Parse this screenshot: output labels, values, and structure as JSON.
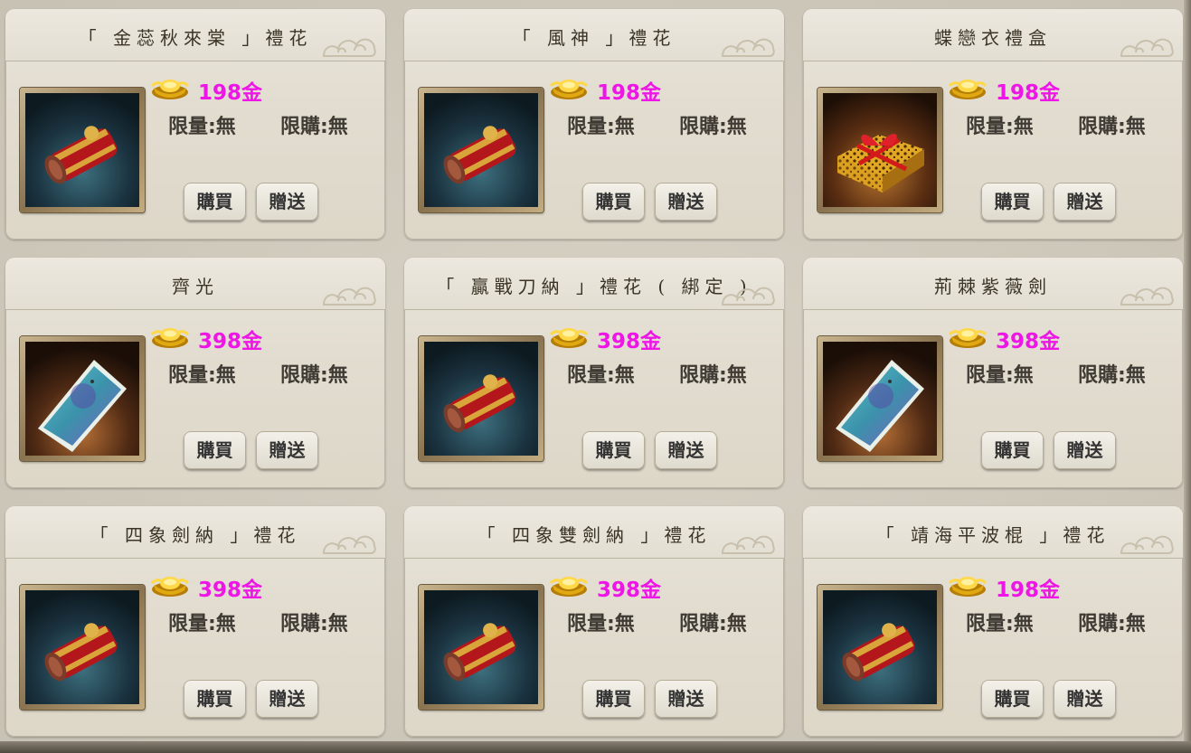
{
  "currency_icon": "gold-ingot-icon",
  "colors": {
    "price": "#ee16e6",
    "card_background": "#e3ded2",
    "text": "#3f3b34"
  },
  "shop": {
    "items": [
      {
        "title": "「 金蕊秋來棠 」禮花",
        "price": "198金",
        "limit_qty": "限量:無",
        "limit_buy": "限購:無",
        "buy_label": "購買",
        "gift_label": "贈送",
        "item_icon": "firework-bundle-icon"
      },
      {
        "title": "「 風神 」禮花",
        "price": "198金",
        "limit_qty": "限量:無",
        "limit_buy": "限購:無",
        "buy_label": "購買",
        "gift_label": "贈送",
        "item_icon": "firework-bundle-icon"
      },
      {
        "title": "蝶戀衣禮盒",
        "price": "198金",
        "limit_qty": "限量:無",
        "limit_buy": "限購:無",
        "buy_label": "購買",
        "gift_label": "贈送",
        "item_icon": "gift-box-icon"
      },
      {
        "title": "齊光",
        "price": "398金",
        "limit_qty": "限量:無",
        "limit_buy": "限購:無",
        "buy_label": "購買",
        "gift_label": "贈送",
        "item_icon": "scroll-card-icon"
      },
      {
        "title": "「 贏戰刀納 」禮花 ( 綁定 )",
        "price": "398金",
        "limit_qty": "限量:無",
        "limit_buy": "限購:無",
        "buy_label": "購買",
        "gift_label": "贈送",
        "item_icon": "firework-bundle-icon"
      },
      {
        "title": "荊棘紫薇劍",
        "price": "398金",
        "limit_qty": "限量:無",
        "limit_buy": "限購:無",
        "buy_label": "購買",
        "gift_label": "贈送",
        "item_icon": "scroll-card-icon"
      },
      {
        "title": "「 四象劍納 」禮花",
        "price": "398金",
        "limit_qty": "限量:無",
        "limit_buy": "限購:無",
        "buy_label": "購買",
        "gift_label": "贈送",
        "item_icon": "firework-bundle-icon"
      },
      {
        "title": "「 四象雙劍納 」禮花",
        "price": "398金",
        "limit_qty": "限量:無",
        "limit_buy": "限購:無",
        "buy_label": "購買",
        "gift_label": "贈送",
        "item_icon": "firework-bundle-icon"
      },
      {
        "title": "「 靖海平波棍 」禮花",
        "price": "198金",
        "limit_qty": "限量:無",
        "limit_buy": "限購:無",
        "buy_label": "購買",
        "gift_label": "贈送",
        "item_icon": "firework-bundle-icon"
      }
    ]
  }
}
